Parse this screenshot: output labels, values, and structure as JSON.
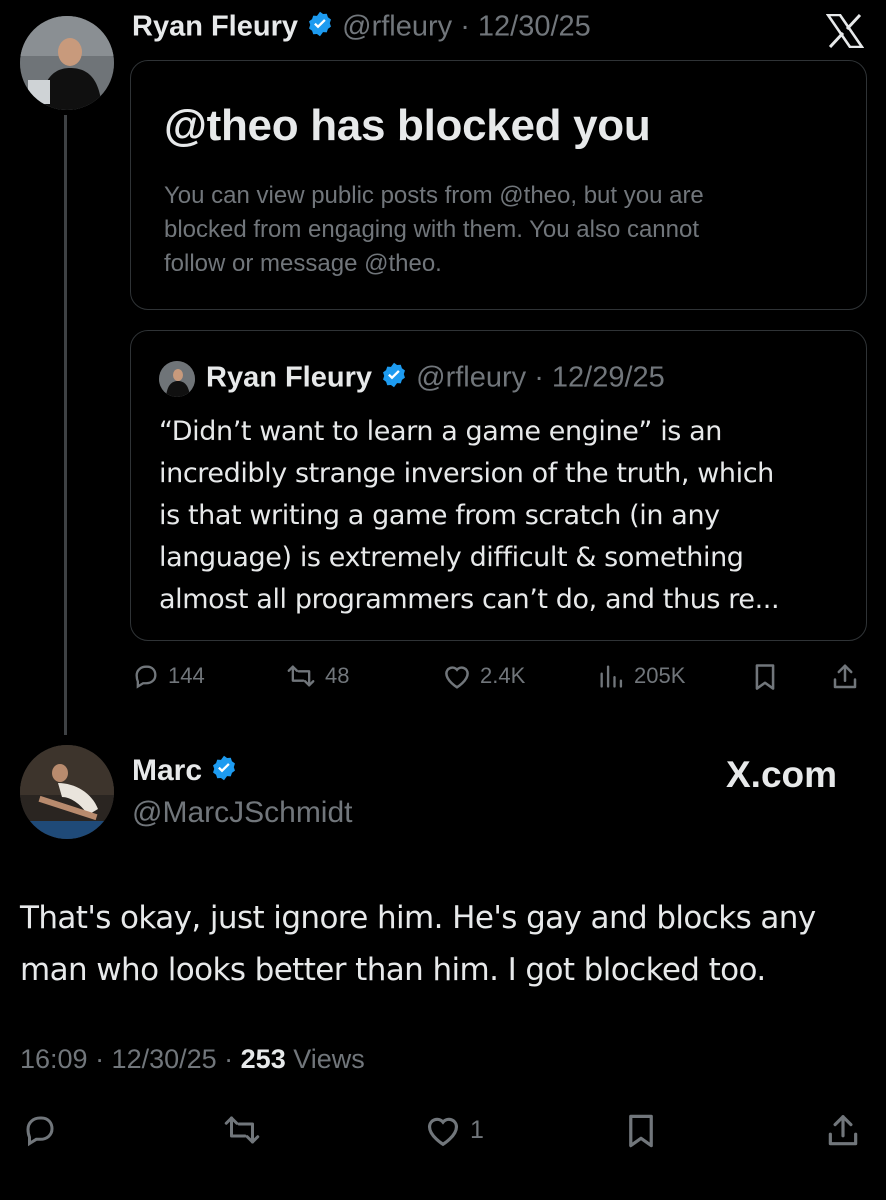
{
  "colors": {
    "background": "#000000",
    "text_primary": "#e7e9ea",
    "text_secondary": "#71767b",
    "border": "#2f3336",
    "verified_blue": "#1d9bf0"
  },
  "first_post": {
    "author_name": "Ryan Fleury",
    "handle_time": "@rfleury · 12/30/25",
    "block_notice": {
      "title": "@theo has blocked you",
      "line1": "You can view public posts from @theo, but you are",
      "line2": "blocked from engaging with them. You also cannot",
      "line3": "follow or message @theo."
    },
    "quoted": {
      "author_name": "Ryan Fleury",
      "handle_time": "@rfleury · 12/29/25",
      "lines": [
        "“Didn’t want to learn a game engine” is an",
        "incredibly strange inversion of the truth, which",
        "is that writing a game from scratch (in any",
        "language) is extremely difficult & something",
        "almost all programmers can’t do, and thus re..."
      ]
    },
    "actions": {
      "replies": "144",
      "reposts": "48",
      "likes": "2.4K",
      "views": "205K"
    }
  },
  "reply": {
    "author_name": "Marc",
    "handle": "@MarcJSchmidt",
    "brand": "X.com",
    "lines": [
      "That's okay, just ignore him. He's gay and blocks any",
      "man who looks better than him. I got blocked too."
    ],
    "time": "16:09 · 12/30/25 · ",
    "views_count": "253",
    "views_label": " Views",
    "likes": "1"
  }
}
